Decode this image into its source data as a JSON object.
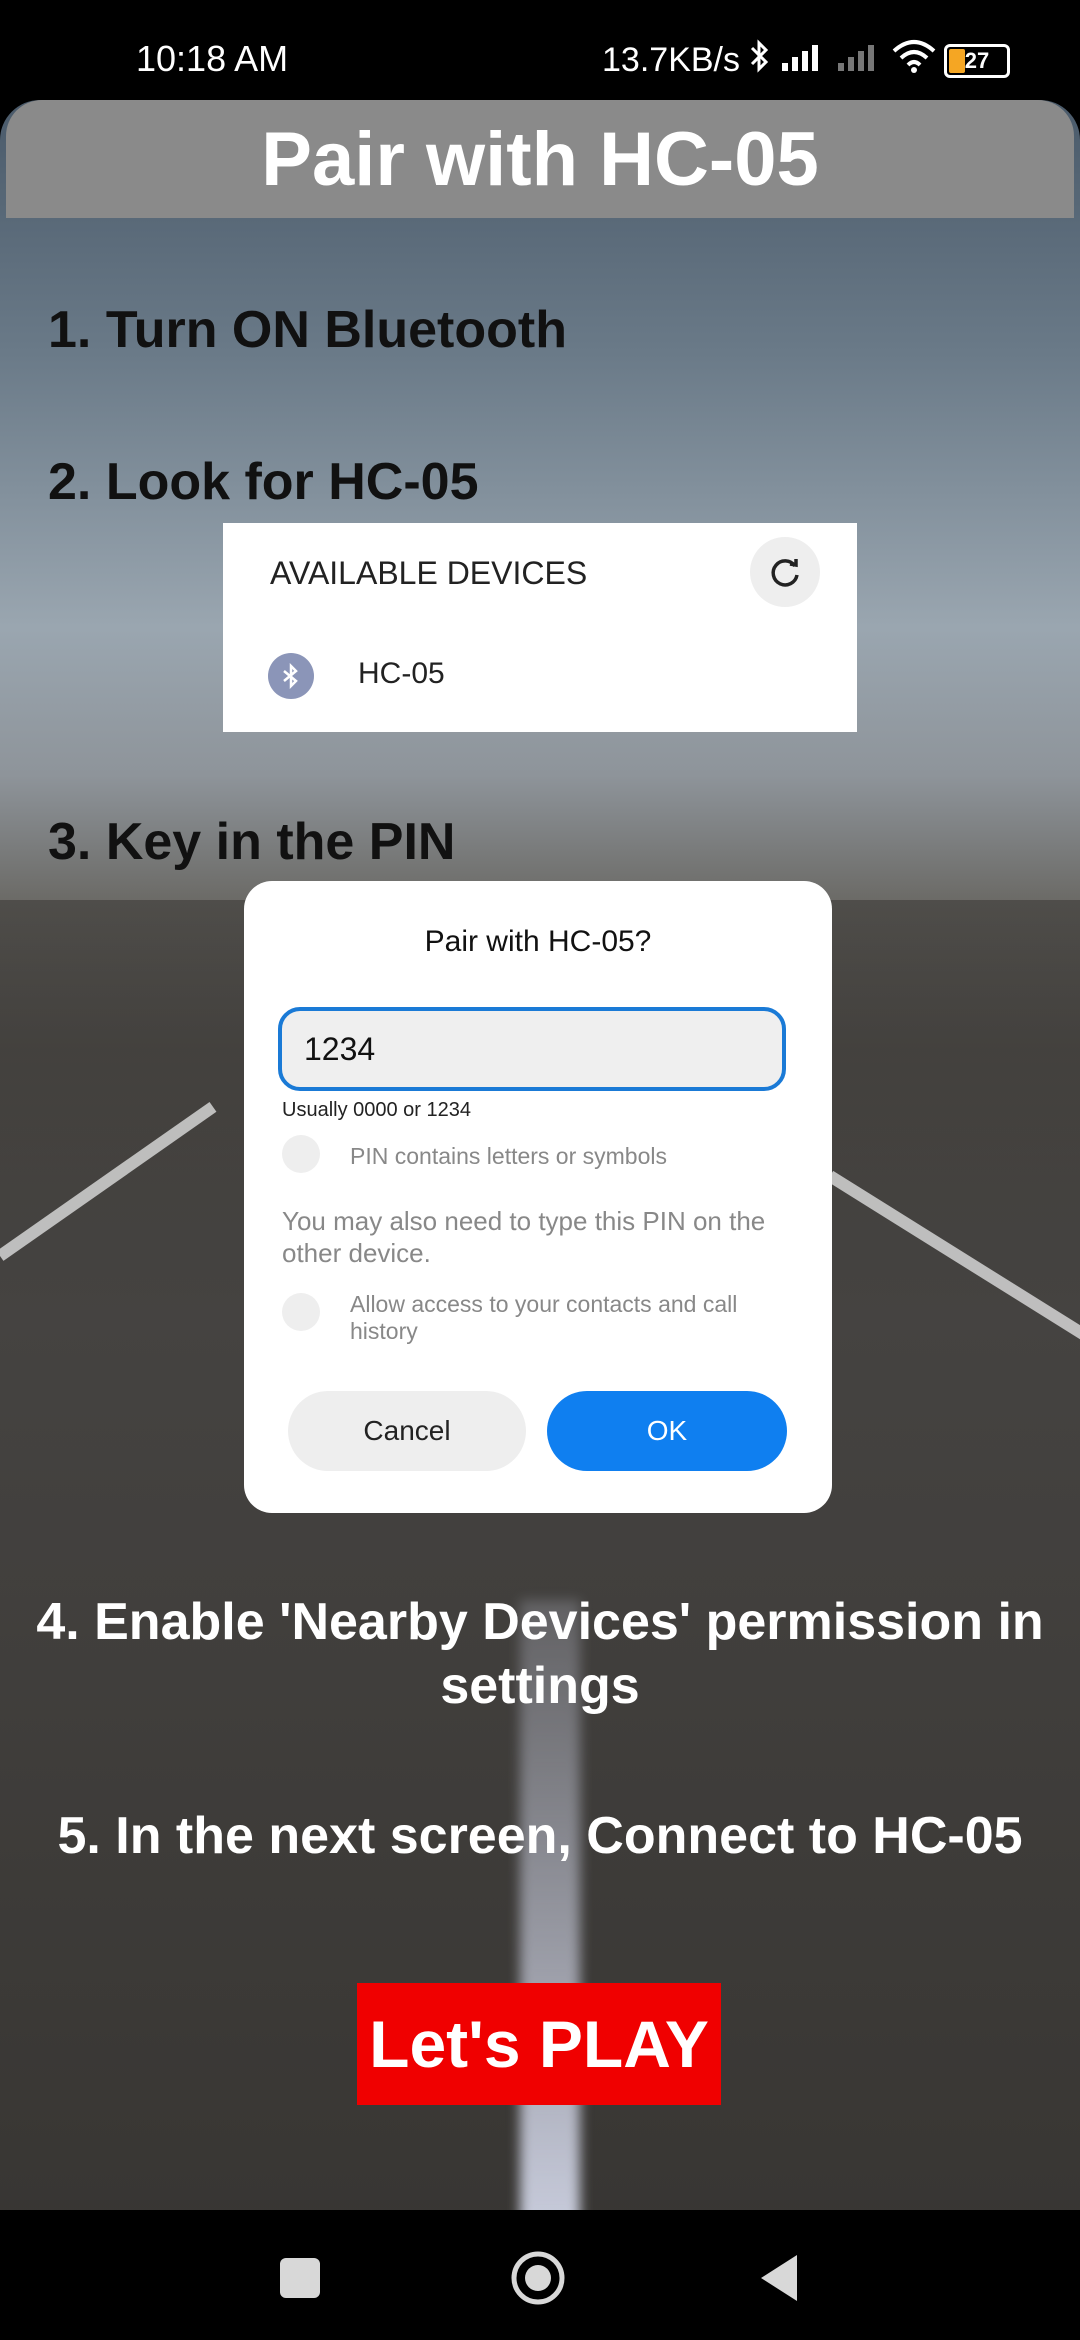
{
  "status": {
    "time": "10:18 AM",
    "net_speed": "13.7KB/s",
    "battery": "27",
    "icons": [
      "bluetooth-icon",
      "signal-icon",
      "signal-off-icon",
      "wifi-icon",
      "battery-icon"
    ]
  },
  "header": {
    "title": "Pair with HC-05"
  },
  "steps": {
    "s1": "1. Turn ON Bluetooth",
    "s2": "2. Look for HC-05",
    "s3": "3. Key in the PIN",
    "s4": "4. Enable 'Nearby Devices' permission in settings",
    "s5": "5. In the next screen, Connect to HC-05"
  },
  "devices": {
    "header": "AVAILABLE DEVICES",
    "device_name": "HC-05"
  },
  "dialog": {
    "title": "Pair with HC-05?",
    "pin_value": "1234",
    "pin_hint": "Usually 0000 or 1234",
    "check1_label": "PIN contains letters or symbols",
    "info": "You may also need to type this PIN on the other device.",
    "check2_label": "Allow access to your contacts and call history",
    "cancel": "Cancel",
    "ok": "OK"
  },
  "play_button": "Let's PLAY",
  "colors": {
    "accent": "#0f7ff0",
    "play": "#f00000",
    "title_bar": "#8a8a8a"
  }
}
